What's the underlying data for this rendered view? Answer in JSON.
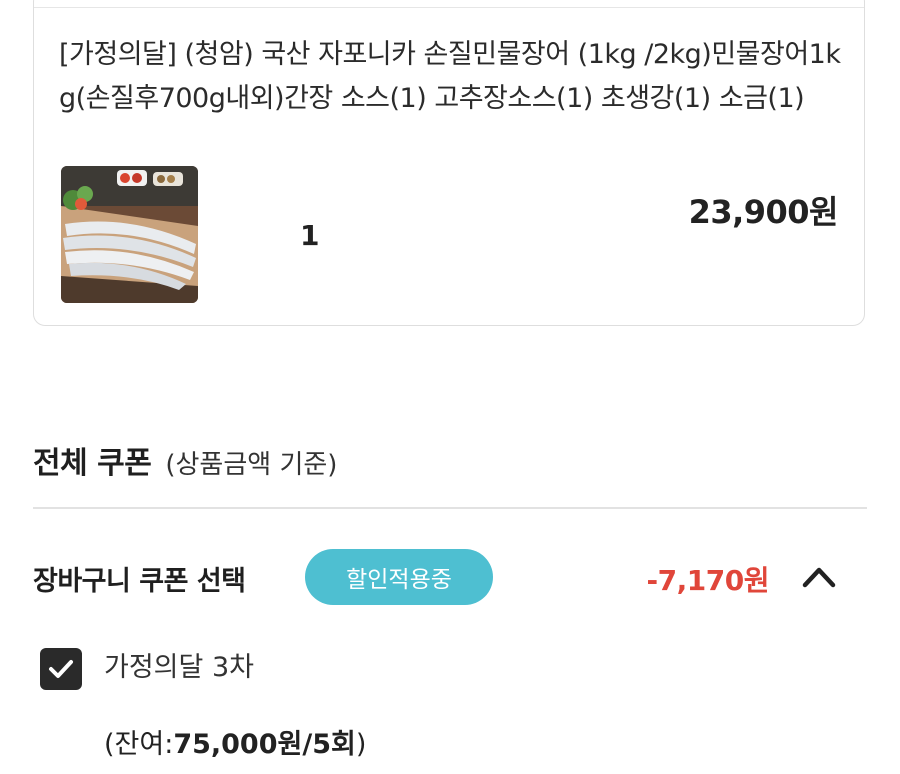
{
  "product": {
    "title": "[가정의달] (청암) 국산 자포니카 손질민물장어 (1kg /2kg)민물장어1kg(손질후700g내외)간장 소스(1) 고추장소스(1) 초생강(1) 소금(1)",
    "quantity": "1",
    "price": "23,900원"
  },
  "coupon_section": {
    "title": "전체 쿠폰",
    "subtitle": "(상품금액 기준)",
    "cart_coupon_label": "장바구니 쿠폰 선택",
    "badge": "할인적용중",
    "discount": "-7,170원",
    "option_label": "가정의달 3차",
    "remaining_prefix": "(잔여:",
    "remaining_value": "75,000원/5회",
    "remaining_suffix": ")"
  },
  "colors": {
    "badge": "#4ebfd1",
    "discount": "#e0463a",
    "checkbox": "#2a2a2a"
  },
  "icons": {
    "collapse": "chevron-up-icon",
    "check": "check-icon"
  }
}
